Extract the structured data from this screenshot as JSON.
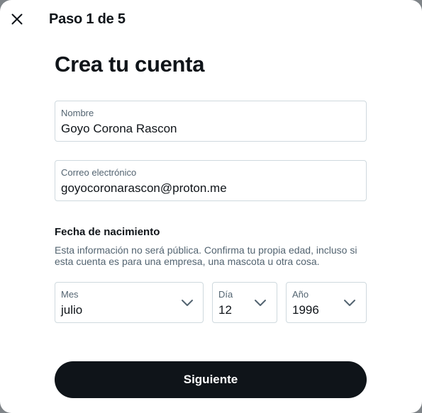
{
  "header": {
    "close_icon": "close-icon",
    "step_label": "Paso 1 de 5"
  },
  "title": "Crea tu cuenta",
  "fields": {
    "name": {
      "label": "Nombre",
      "value": "Goyo Corona Rascon"
    },
    "email": {
      "label": "Correo electrónico",
      "value": "goyocoronarascon@proton.me"
    }
  },
  "birthdate": {
    "title": "Fecha de nacimiento",
    "description": "Esta información no será pública. Confirma tu propia edad, incluso si esta cuenta es para una empresa, una mascota u otra cosa.",
    "month": {
      "label": "Mes",
      "value": "julio"
    },
    "day": {
      "label": "Día",
      "value": "12"
    },
    "year": {
      "label": "Año",
      "value": "1996"
    },
    "chevron_icon": "chevron-down-icon"
  },
  "actions": {
    "next_label": "Siguiente"
  },
  "colors": {
    "text": "#0f1419",
    "muted": "#536471",
    "border": "#cfd9de",
    "button_bg": "#0f1419",
    "button_text": "#ffffff"
  }
}
